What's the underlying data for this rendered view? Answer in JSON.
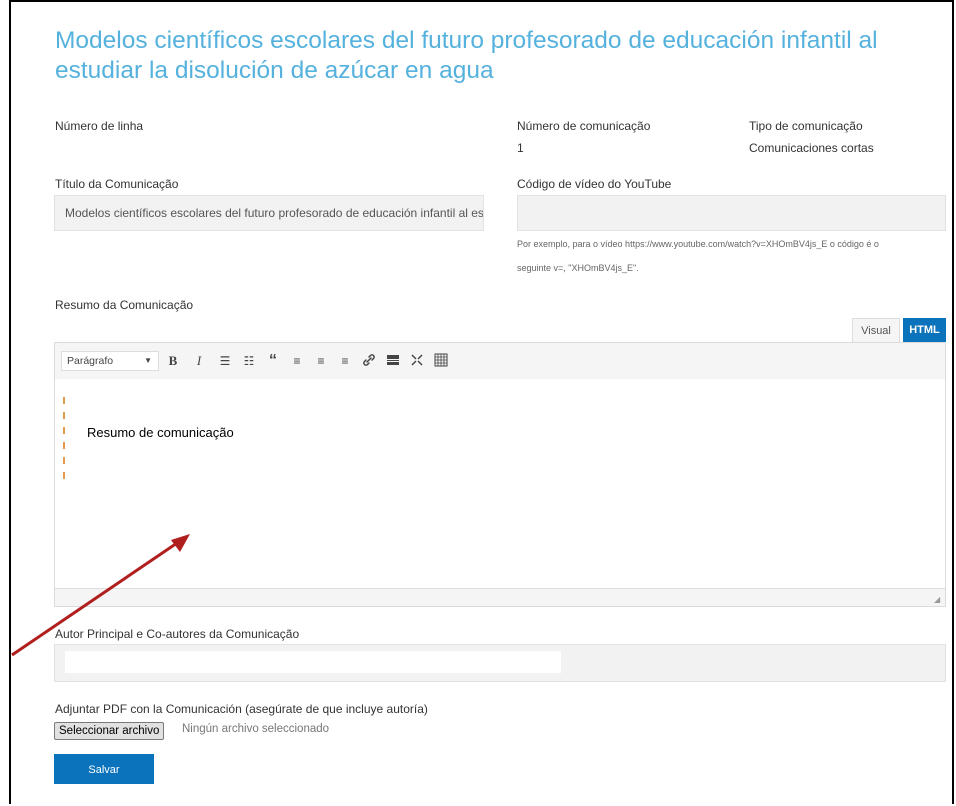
{
  "title": "Modelos científicos escolares del futuro profesorado de educación infantil al estudiar la disolución de azúcar en agua",
  "numero_linha": {
    "label": "Número de linha"
  },
  "numero_comunicacao": {
    "label": "Número de comunicação",
    "value": "1"
  },
  "tipo_comunicacao": {
    "label": "Tipo de comunicação",
    "value": "Comunicaciones cortas"
  },
  "titulo_comunicacao": {
    "label": "Título da Comunicação",
    "value": "Modelos científicos escolares del futuro profesorado de educación infantil al estudiar la disolución de azúcar en agua"
  },
  "youtube": {
    "label": "Código de vídeo do YouTube",
    "value": "",
    "hint_line1": "Por exemplo, para o vídeo https://www.youtube.com/watch?v=XHOmBV4js_E o código é o",
    "hint_line2": "seguinte v=, \"XHOmBV4js_E\"."
  },
  "resumo": {
    "label": "Resumo da Comunicação",
    "tab_visual": "Visual",
    "tab_html": "HTML",
    "format_select": "Parágrafo",
    "body_text": "Resumo de comunicação"
  },
  "autores": {
    "label": "Autor Principal e Co-autores da Comunicação",
    "value": ""
  },
  "pdf": {
    "label": "Adjuntar PDF con la Comunicación (asegúrate de que incluye autoría)",
    "button": "Seleccionar archivo",
    "status": "Ningún archivo seleccionado"
  },
  "save_button": "Salvar",
  "colors": {
    "title": "#55b1dd",
    "primary": "#0a73bb",
    "annotation_arrow": "#b01e1e"
  },
  "toolbar_icons": [
    "bold-icon",
    "italic-icon",
    "bullet-list-icon",
    "numbered-list-icon",
    "blockquote-icon",
    "align-left-icon",
    "align-center-icon",
    "align-right-icon",
    "link-icon",
    "read-more-icon",
    "fullscreen-icon",
    "toolbar-toggle-icon"
  ]
}
